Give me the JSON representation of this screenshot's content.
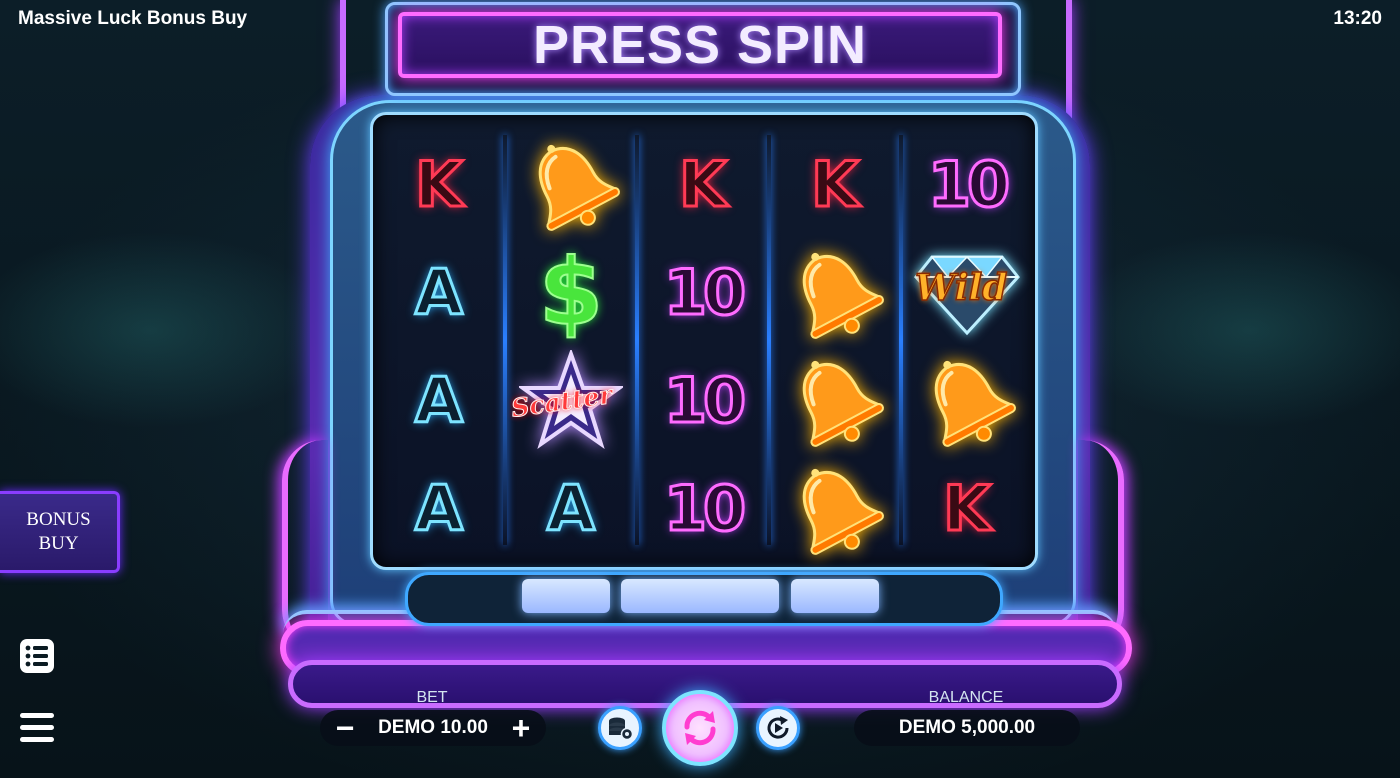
{
  "header": {
    "title": "Massive Luck Bonus Buy",
    "clock": "13:20",
    "banner": "PRESS SPIN"
  },
  "reels": [
    [
      {
        "symbol": "K"
      },
      {
        "symbol": "A"
      },
      {
        "symbol": "A"
      },
      {
        "symbol": "A"
      }
    ],
    [
      {
        "symbol": "bell-icon"
      },
      {
        "symbol": "dollar-icon",
        "text": "$"
      },
      {
        "symbol": "scatter-star-icon",
        "text": "Scatter"
      },
      {
        "symbol": "A"
      }
    ],
    [
      {
        "symbol": "K"
      },
      {
        "symbol": "10"
      },
      {
        "symbol": "10"
      },
      {
        "symbol": "10"
      }
    ],
    [
      {
        "symbol": "K"
      },
      {
        "symbol": "bell-icon"
      },
      {
        "symbol": "bell-icon"
      },
      {
        "symbol": "bell-icon"
      }
    ],
    [
      {
        "symbol": "10"
      },
      {
        "symbol": "wild-diamond-icon",
        "text": "Wild"
      },
      {
        "symbol": "bell-icon"
      },
      {
        "symbol": "K"
      }
    ]
  ],
  "controls": {
    "bet_label": "BET",
    "bet_value": "DEMO 10.00",
    "minus": "−",
    "plus": "+",
    "balance_label": "BALANCE",
    "balance_value": "DEMO 5,000.00"
  },
  "side": {
    "bonus_buy_line1": "BONUS",
    "bonus_buy_line2": "BUY"
  },
  "colors": {
    "neon_pink": "#ff6bff",
    "neon_cyan": "#7de4ff",
    "k_red": "#ff3a55",
    "dollar_green": "#49e53c"
  }
}
